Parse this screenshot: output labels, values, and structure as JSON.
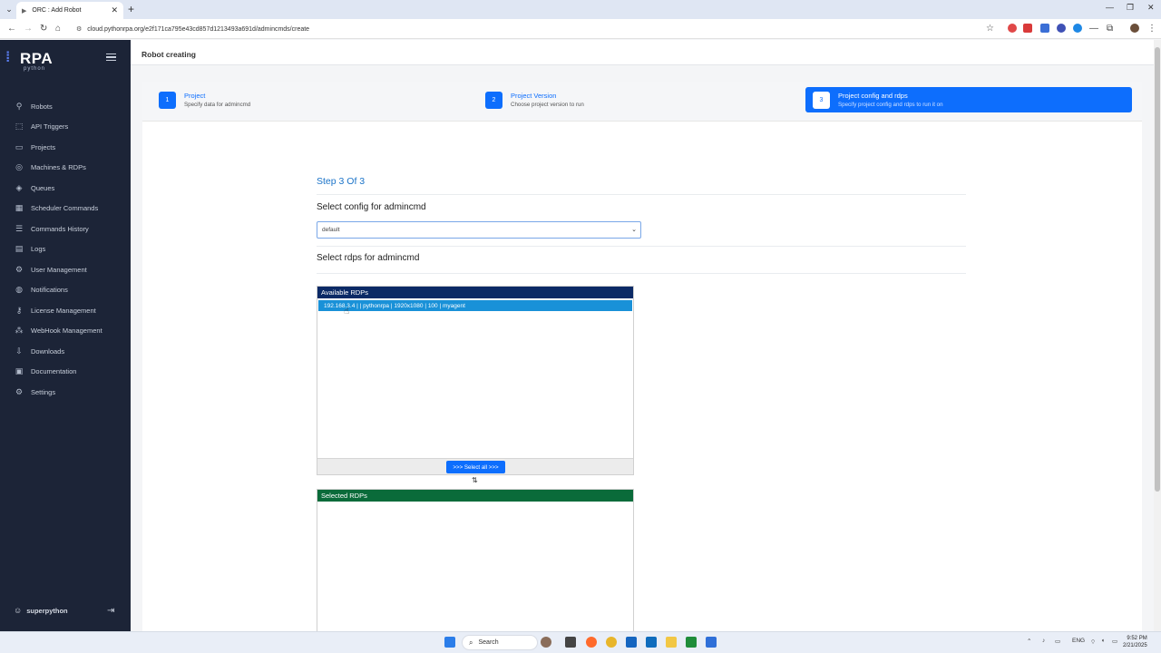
{
  "browser": {
    "tab_title": "ORC : Add Robot",
    "tab_favicon": "▶",
    "url": "cloud.pythonrpa.org/e2f171ca795e43cd857d1213493a691d/admincmds/create"
  },
  "sidebar": {
    "logo_text": "RPA",
    "logo_sub": "python",
    "items": [
      {
        "label": "Robots",
        "icon": "robot-icon"
      },
      {
        "label": "API Triggers",
        "icon": "api-icon"
      },
      {
        "label": "Projects",
        "icon": "folder-icon"
      },
      {
        "label": "Machines & RDPs",
        "icon": "machine-icon"
      },
      {
        "label": "Queues",
        "icon": "layers-icon"
      },
      {
        "label": "Scheduler Commands",
        "icon": "calendar-icon"
      },
      {
        "label": "Commands History",
        "icon": "list-icon"
      },
      {
        "label": "Logs",
        "icon": "log-icon"
      },
      {
        "label": "User Management",
        "icon": "gear-user-icon"
      },
      {
        "label": "Notifications",
        "icon": "bell-icon"
      },
      {
        "label": "License Management",
        "icon": "key-icon"
      },
      {
        "label": "WebHook Management",
        "icon": "webhook-icon"
      },
      {
        "label": "Downloads",
        "icon": "download-icon"
      },
      {
        "label": "Documentation",
        "icon": "book-icon"
      },
      {
        "label": "Settings",
        "icon": "gear-icon"
      }
    ],
    "user": "superpython"
  },
  "header": {
    "title": "Robot creating"
  },
  "stepper": {
    "steps": [
      {
        "num": "1",
        "title": "Project",
        "subtitle": "Specify data for admincmd"
      },
      {
        "num": "2",
        "title": "Project Version",
        "subtitle": "Choose project version to run"
      },
      {
        "num": "3",
        "title": "Project config and rdps",
        "subtitle": "Specify project config and rdps to run it on"
      }
    ]
  },
  "form": {
    "step_label": "Step 3 Of 3",
    "config_title": "Select config for admincmd",
    "config_value": "default",
    "rdps_title": "Select rdps for admincmd",
    "available_title": "Available RDPs",
    "available_items": [
      "192.168.3.4 |  | pythonrpa | 1920x1080 | 100 | myagent"
    ],
    "select_all_label": ">>> Select all >>>",
    "selected_title": "Selected RDPs"
  },
  "taskbar": {
    "search_label": "Search",
    "lang": "ENG",
    "time": "9:52 PM",
    "date": "2/21/2025"
  },
  "colors": {
    "sidebar_bg": "#1c2437",
    "primary": "#0d6efd",
    "available_head": "#0b2a66",
    "selected_head": "#0a6b3a",
    "rdp_row": "#1991d8"
  }
}
